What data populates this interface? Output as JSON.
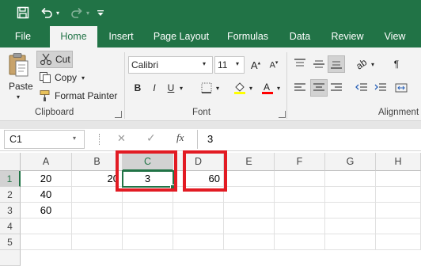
{
  "qat": {
    "save_icon": "save-icon",
    "undo_icon": "undo-icon",
    "redo_icon": "redo-icon",
    "customize_icon": "customize-qat-icon"
  },
  "tabs": [
    "File",
    "Home",
    "Insert",
    "Page Layout",
    "Formulas",
    "Data",
    "Review",
    "View"
  ],
  "active_tab": "Home",
  "clipboard": {
    "paste_label": "Paste",
    "cut_label": "Cut",
    "copy_label": "Copy",
    "format_painter_label": "Format Painter",
    "group_label": "Clipboard"
  },
  "font": {
    "font_name": "Calibri",
    "font_size": "11",
    "bold": "B",
    "italic": "I",
    "underline": "U",
    "group_label": "Font",
    "font_color_glyph": "A"
  },
  "alignment": {
    "group_label": "Alignment"
  },
  "formula_bar": {
    "name_box": "C1",
    "cancel_glyph": "✕",
    "enter_glyph": "✓",
    "fx_label": "fx",
    "content": "3"
  },
  "grid": {
    "columns": [
      "A",
      "B",
      "C",
      "D",
      "E",
      "F",
      "G",
      "H"
    ],
    "rows": [
      "1",
      "2",
      "3",
      "4",
      "5"
    ],
    "cells": {
      "A1": "20",
      "B1": "20",
      "C1": "3",
      "D1": "60",
      "A2": "40",
      "A3": "60"
    },
    "active_cell": "C1"
  },
  "colors": {
    "brand_green": "#217346",
    "highlight_red": "#e21b23",
    "fill_yellow": "#ffff00",
    "font_red": "#ff0000"
  }
}
